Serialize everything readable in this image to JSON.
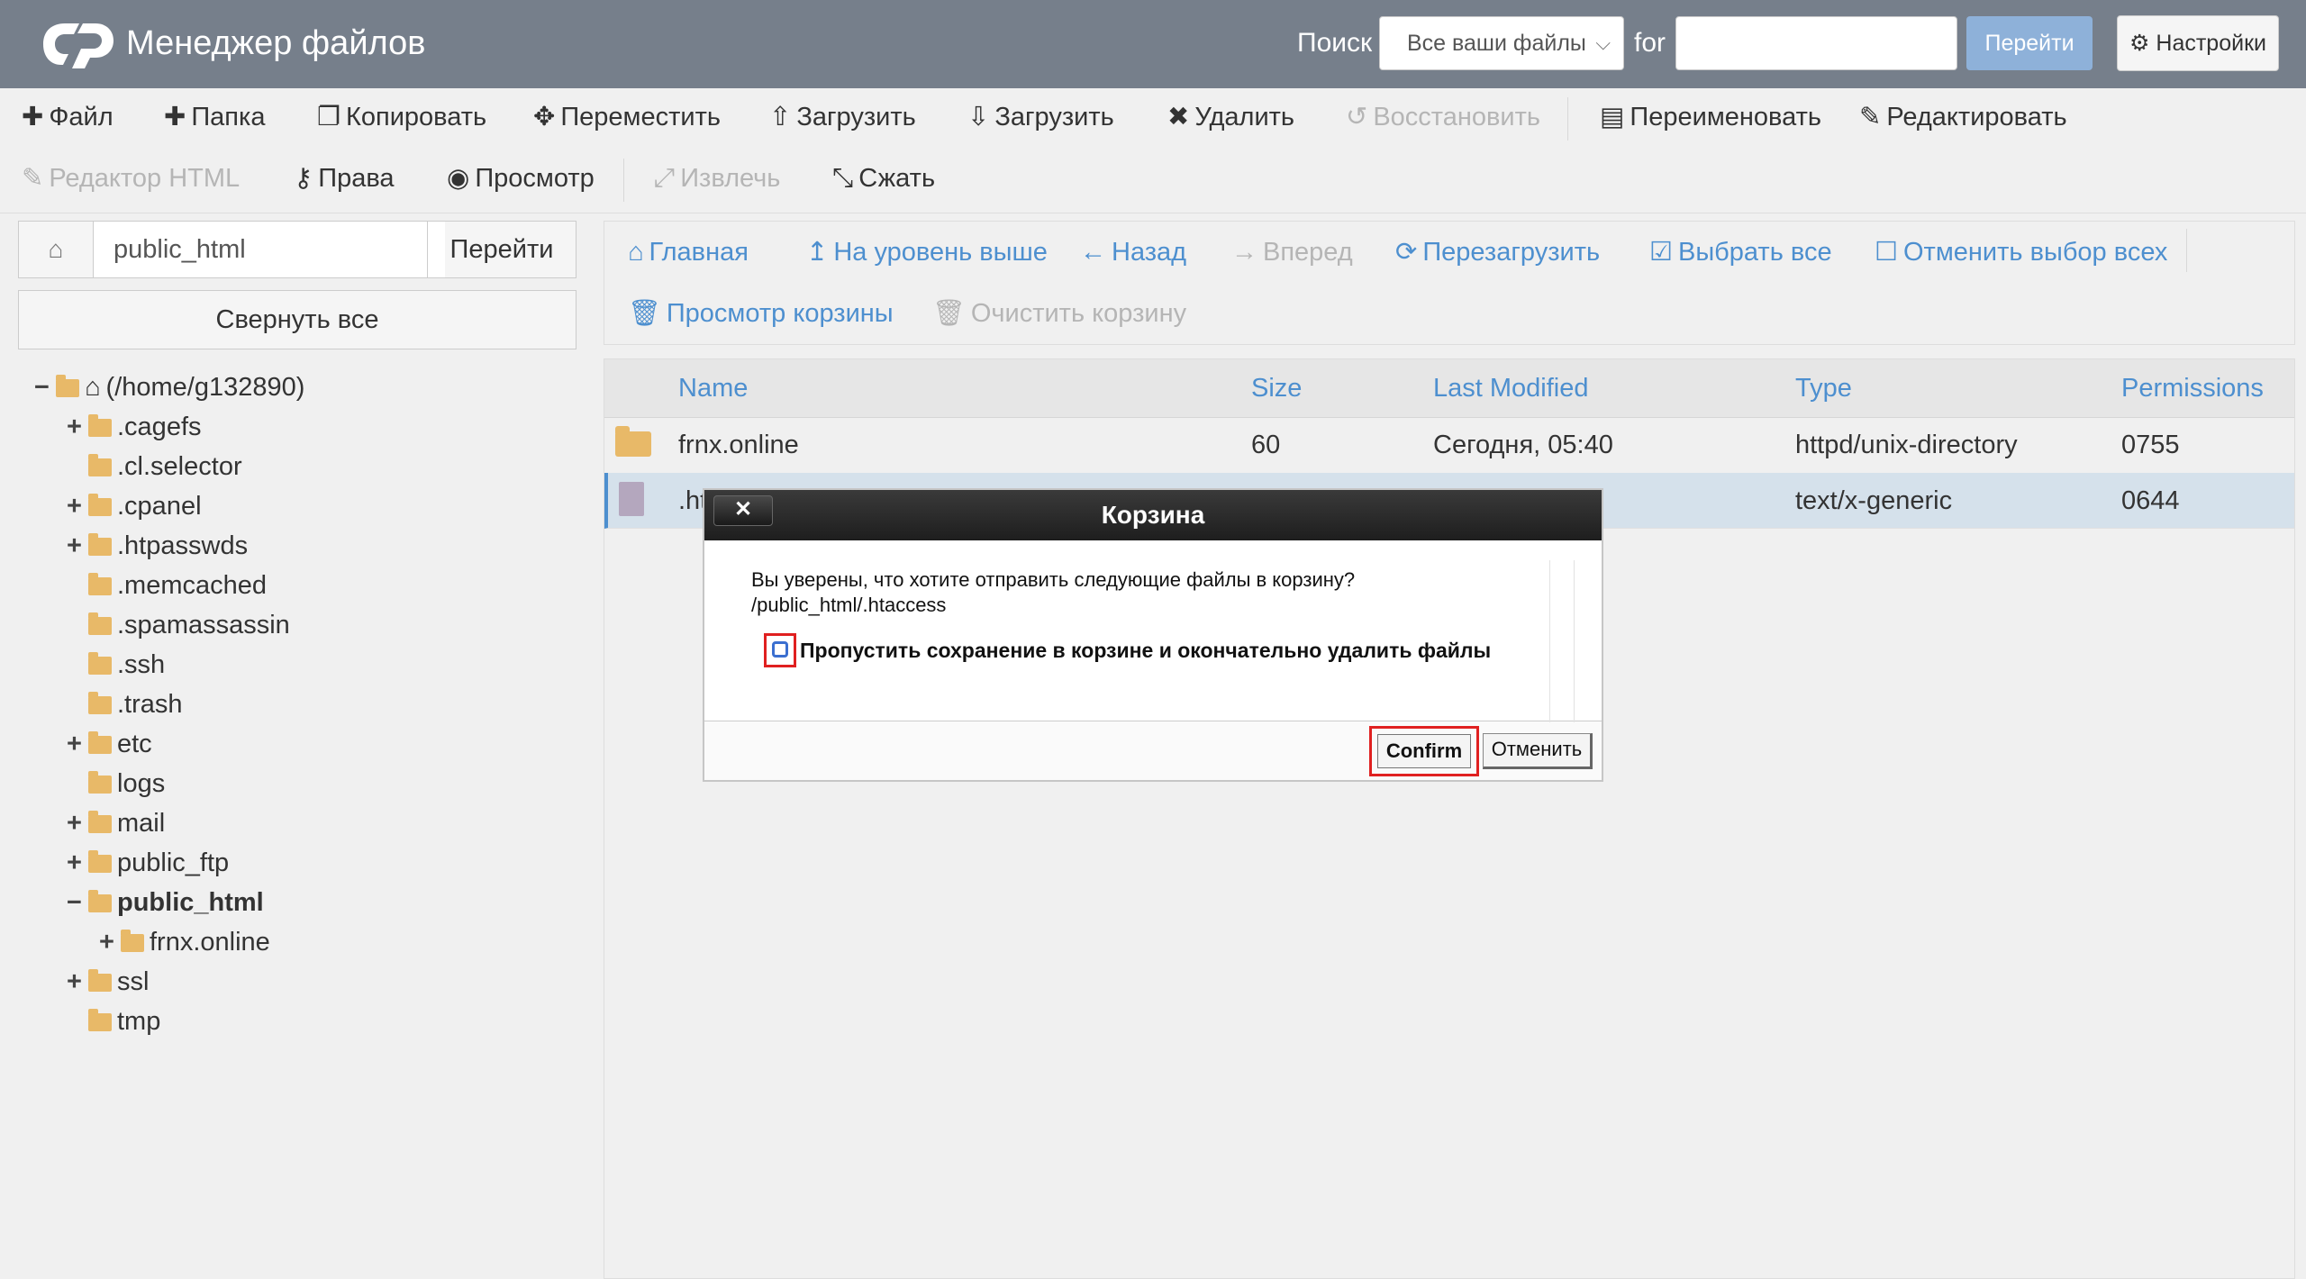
{
  "header": {
    "title": "Менеджер файлов",
    "search_label": "Поиск",
    "search_scope": "Все ваши файлы",
    "for_label": "for",
    "search_value": "",
    "go_label": "Перейти",
    "settings_label": "Настройки"
  },
  "toolbar": {
    "file": "Файл",
    "folder": "Папка",
    "copy": "Копировать",
    "move": "Переместить",
    "upload": "Загрузить",
    "download": "Загрузить",
    "delete": "Удалить",
    "restore": "Восстановить",
    "rename": "Переименовать",
    "edit": "Редактировать",
    "html_editor": "Редактор HTML",
    "permissions": "Права",
    "view": "Просмотр",
    "extract": "Извлечь",
    "compress": "Сжать"
  },
  "left": {
    "path_value": "public_html",
    "path_go": "Перейти",
    "collapse_all": "Свернуть все",
    "tree": [
      {
        "label": "(/home/g132890)",
        "toggle": "−"
      },
      {
        "label": ".cagefs",
        "toggle": "+"
      },
      {
        "label": ".cl.selector",
        "toggle": ""
      },
      {
        "label": ".cpanel",
        "toggle": "+"
      },
      {
        "label": ".htpasswds",
        "toggle": "+"
      },
      {
        "label": ".memcached",
        "toggle": ""
      },
      {
        "label": ".spamassassin",
        "toggle": ""
      },
      {
        "label": ".ssh",
        "toggle": ""
      },
      {
        "label": ".trash",
        "toggle": ""
      },
      {
        "label": "etc",
        "toggle": "+"
      },
      {
        "label": "logs",
        "toggle": ""
      },
      {
        "label": "mail",
        "toggle": "+"
      },
      {
        "label": "public_ftp",
        "toggle": "+"
      },
      {
        "label": "public_html",
        "toggle": "−"
      },
      {
        "label": "frnx.online",
        "toggle": "+"
      },
      {
        "label": "ssl",
        "toggle": "+"
      },
      {
        "label": "tmp",
        "toggle": ""
      }
    ]
  },
  "nav": {
    "home": "Главная",
    "up": "На уровень выше",
    "back": "Назад",
    "forward": "Вперед",
    "reload": "Перезагрузить",
    "select_all": "Выбрать все",
    "deselect_all": "Отменить выбор всех",
    "view_trash": "Просмотр корзины",
    "empty_trash": "Очистить корзину"
  },
  "table": {
    "columns": [
      "Name",
      "Size",
      "Last Modified",
      "Type",
      "Permissions"
    ],
    "rows": [
      {
        "name": "frnx.online",
        "size": "60",
        "modified": "Сегодня, 05:40",
        "type": "httpd/unix-directory",
        "perms": "0755"
      },
      {
        "name": ".ht",
        "size": "",
        "modified": "",
        "type": "text/x-generic",
        "perms": "0644"
      }
    ]
  },
  "modal": {
    "close": "✕",
    "title": "Корзина",
    "message": "Вы уверены, что хотите отправить следующие файлы в корзину?",
    "path": "/public_html/.htaccess",
    "skip_trash_label": "Пропустить сохранение в корзине и окончательно удалить файлы",
    "confirm": "Confirm",
    "cancel": "Отменить"
  },
  "colors": {
    "header_bg": "#767f8b",
    "link_blue": "#4d8fcf",
    "folder": "#e8b968",
    "highlight_red": "#e02020"
  }
}
